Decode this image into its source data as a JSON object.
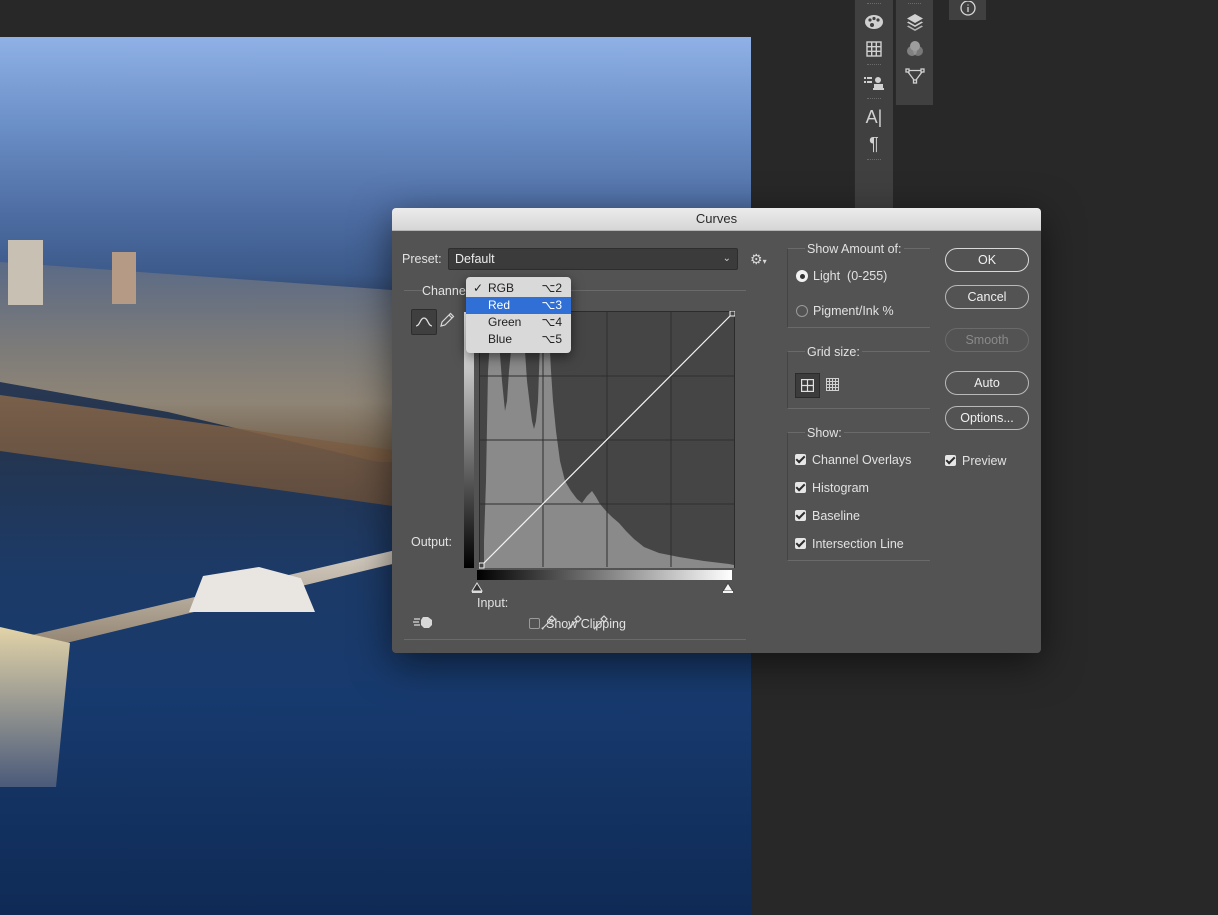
{
  "dialog": {
    "title": "Curves",
    "preset_label": "Preset:",
    "preset_value": "Default",
    "channel_label": "Channel:",
    "channel_options": [
      {
        "label": "RGB",
        "shortcut": "⌥2",
        "checked": true,
        "highlighted": false
      },
      {
        "label": "Red",
        "shortcut": "⌥3",
        "checked": false,
        "highlighted": true
      },
      {
        "label": "Green",
        "shortcut": "⌥4",
        "checked": false,
        "highlighted": false
      },
      {
        "label": "Blue",
        "shortcut": "⌥5",
        "checked": false,
        "highlighted": false
      }
    ],
    "output_label": "Output:",
    "input_label": "Input:",
    "show_clipping_label": "Show Clipping",
    "show_clipping_checked": false,
    "show_amount_title": "Show Amount of:",
    "light_label": "Light  (0-255)",
    "pigment_label": "Pigment/Ink %",
    "amount_selected": "light",
    "grid_size_title": "Grid size:",
    "show_title": "Show:",
    "show_options": [
      {
        "label": "Channel Overlays",
        "checked": true
      },
      {
        "label": "Histogram",
        "checked": true
      },
      {
        "label": "Baseline",
        "checked": true
      },
      {
        "label": "Intersection Line",
        "checked": true
      }
    ],
    "buttons": {
      "ok": "OK",
      "cancel": "Cancel",
      "smooth": "Smooth",
      "auto": "Auto",
      "options": "Options..."
    },
    "preview_label": "Preview",
    "preview_checked": true
  },
  "panels": {
    "type_glyph": "A|",
    "paragraph_glyph": "¶"
  },
  "colors": {
    "dialog_bg": "#535353",
    "highlight": "#2f6fd6",
    "app_bg": "#282828"
  }
}
